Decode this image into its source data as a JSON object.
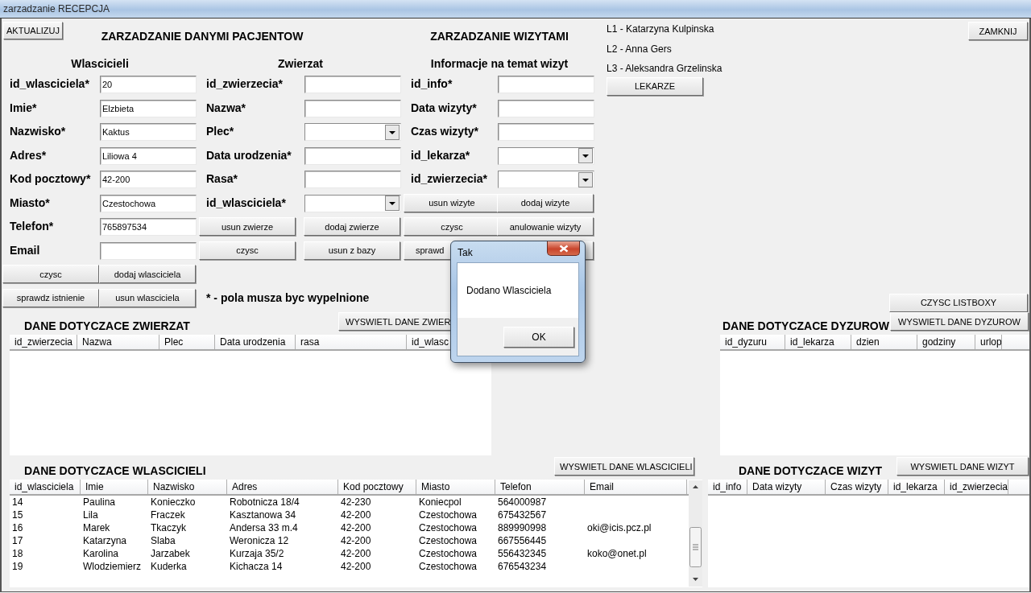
{
  "window": {
    "title": "zarzadzanie RECEPCJA"
  },
  "toolbar": {
    "refresh_button": "AKTUALIZUJ",
    "close_button": "ZAMKNIJ",
    "clear_lists_button": "CZYSC LISTBOXY"
  },
  "headings": [
    "ZARZADZANIE DANYMI PACJENTOW",
    "ZARZADZANIE WIZYTAMI"
  ],
  "forms": [
    {
      "title": "Wlascicieli",
      "fields": [
        {
          "label": "id_wlasciciela*",
          "kind": "text",
          "value": "20"
        },
        {
          "label": "Imie*",
          "kind": "text",
          "value": "Elzbieta"
        },
        {
          "label": "Nazwisko*",
          "kind": "text",
          "value": "Kaktus"
        },
        {
          "label": "Adres*",
          "kind": "text",
          "value": "Liliowa 4"
        },
        {
          "label": "Kod pocztowy*",
          "kind": "text",
          "value": "42-200"
        },
        {
          "label": "Miasto*",
          "kind": "text",
          "value": "Czestochowa"
        },
        {
          "label": "Telefon*",
          "kind": "text",
          "value": "765897534"
        },
        {
          "label": "Email",
          "kind": "text"
        }
      ],
      "buttons": [
        {
          "kind": "button",
          "label": "czysc"
        },
        {
          "kind": "button",
          "label": "dodaj wlasciciela"
        },
        {
          "kind": "button",
          "label": "sprawdz istnienie"
        },
        {
          "kind": "button",
          "label": "usun wlasciciela"
        }
      ]
    },
    {
      "title": "Zwierzat",
      "fields": [
        {
          "label": "id_zwierzecia*",
          "kind": "text"
        },
        {
          "label": "Nazwa*",
          "kind": "text"
        },
        {
          "label": "Plec*",
          "kind": "dropdown"
        },
        {
          "label": "Data urodzenia*",
          "kind": "text"
        },
        {
          "label": "Rasa*",
          "kind": "text"
        },
        {
          "label": "id_wlasciciela*",
          "kind": "dropdown"
        }
      ],
      "buttons": [
        {
          "kind": "button",
          "label": "usun zwierze"
        },
        {
          "kind": "button",
          "label": "dodaj zwierze"
        },
        {
          "kind": "button",
          "label": "czysc"
        },
        {
          "kind": "button",
          "label": "usun z bazy"
        }
      ]
    },
    {
      "title": "Informacje na temat wizyt",
      "fields": [
        {
          "label": "id_info*",
          "kind": "text"
        },
        {
          "label": "Data wizyty*",
          "kind": "text"
        },
        {
          "label": "Czas wizyty*",
          "kind": "text"
        },
        {
          "label": "id_lekarza*",
          "kind": "dropdown"
        },
        {
          "label": "id_zwierzecia*",
          "kind": "dropdown"
        }
      ],
      "buttons": [
        {
          "kind": "button",
          "label": "usun wizyte"
        },
        {
          "kind": "button",
          "label": "dodaj wizyte"
        },
        {
          "kind": "button",
          "label": "czysc"
        },
        {
          "kind": "button",
          "label": "anulowanie wizyty"
        },
        {
          "kind": "button",
          "label": "sprawd"
        },
        {
          "kind": "button"
        }
      ]
    }
  ],
  "note": "* - pola musza byc wypelnione",
  "doctors": {
    "labels": [
      "L1 - Katarzyna Kulpinska",
      "L2 - Anna Gers",
      "L3 - Aleksandra Grzelinska"
    ],
    "button": "LEKARZE"
  },
  "lists": [
    {
      "title": "DANE DOTYCZACE ZWIERZAT",
      "button": "WYSWIETL DANE ZWIER",
      "columns": [
        "id_zwierzecia",
        "Nazwa",
        "Plec",
        "Data urodzenia",
        "rasa",
        "id_wlasc"
      ]
    },
    {
      "title": "DANE DOTYCZACE DYZUROW",
      "button": "WYSWIETL DANE DYZUROW",
      "columns": [
        "id_dyzuru",
        "id_lekarza",
        "dzien",
        "godziny",
        "urlop"
      ]
    },
    {
      "title": "DANE DOTYCZACE WLASCICIELI",
      "button": "WYSWIETL DANE WLASCICIELI",
      "columns": [
        "id_wlasciciela",
        "Imie",
        "Nazwisko",
        "Adres",
        "Kod pocztowy",
        "Miasto",
        "Telefon",
        "Email"
      ],
      "rows": [
        [
          "14",
          "Paulina",
          "Konieczko",
          "Robotnicza 18/4",
          "42-230",
          "Koniecpol",
          "564000987"
        ],
        [
          "15",
          "Lila",
          "Fraczek",
          "Kasztanowa 34",
          "42-200",
          "Czestochowa",
          "675432567"
        ],
        [
          "16",
          "Marek",
          "Tkaczyk",
          "Andersa 33 m.4",
          "42-200",
          "Czestochowa",
          "889990998",
          "oki@icis.pcz.pl"
        ],
        [
          "17",
          "Katarzyna",
          "Slaba",
          "Weronicza 12",
          "42-200",
          "Czestochowa",
          "667556445"
        ],
        [
          "18",
          "Karolina",
          "Jarzabek",
          "Kurzaja 35/2",
          "42-200",
          "Czestochowa",
          "556432345",
          "koko@onet.pl"
        ],
        [
          "19",
          "Wlodziemierz",
          "Kuderka",
          "Kichacza 14",
          "42-200",
          "Czestochowa",
          "676543234"
        ]
      ]
    },
    {
      "title": "DANE DOTYCZACE WIZYT",
      "button": "WYSWIETL DANE WIZYT",
      "columns": [
        "id_info",
        "Data wizyty",
        "Czas wizyty",
        "id_lekarza",
        "id_zwierzecia"
      ]
    }
  ],
  "dialog": {
    "title": "Tak",
    "message": "Dodano Wlasciciela",
    "button": "OK"
  }
}
